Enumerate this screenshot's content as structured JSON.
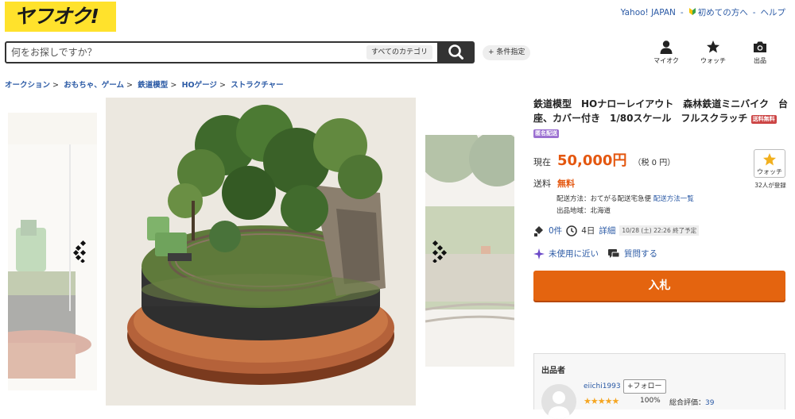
{
  "header": {
    "logo_text": "ヤフオク!",
    "links": [
      "Yahoo! JAPAN",
      "初めての方へ",
      "ヘルプ"
    ],
    "search_placeholder": "何をお探しですか？",
    "category_label": "すべてのカテゴリ",
    "condition_label": "+ 条件指定",
    "icons": [
      {
        "name": "user-icon",
        "label": "マイオク"
      },
      {
        "name": "star-icon",
        "label": "ウォッチ"
      },
      {
        "name": "camera-icon",
        "label": "出品"
      }
    ]
  },
  "breadcrumb": [
    "オークション",
    "おもちゃ、ゲーム",
    "鉄道模型",
    "HOゲージ",
    "ストラクチャー"
  ],
  "item": {
    "title": "鉄道模型　HOナローレイアウト　森林鉄道ミニバイク　台座、カバー付き　1/80スケール　フルスクラッチ",
    "badge_free_shipping": "送料無料",
    "badge_anonymous": "匿名配送",
    "price_label": "現在",
    "price": "50,000円",
    "tax": "（税 0 円）",
    "shipping_label": "送料",
    "shipping_value": "無料",
    "shipping_method": "配送方法：おてがる配送宅急便",
    "shipping_list_link": "配送方法一覧",
    "ship_region": "出品地域：北海道",
    "bids": "0件",
    "time_left": "4日",
    "detail_link": "詳細",
    "end_time": "10/28 (土) 22:26 終了予定",
    "condition": "未使用に近い",
    "question_link": "質問する",
    "bid_button": "入札"
  },
  "watch": {
    "label": "ウォッチ",
    "count": "32人が登録"
  },
  "seller": {
    "heading": "出品者",
    "name": "eiichi1993",
    "follow": "+フォロー",
    "stars": "★★★★★",
    "percent": "100%",
    "total_label": "総合評価：",
    "total_value": "39"
  },
  "colors": {
    "accent": "#e4570f",
    "link": "#2b5aa5",
    "logo_bg": "#ffe22c",
    "bid_button": "#e4640f"
  }
}
